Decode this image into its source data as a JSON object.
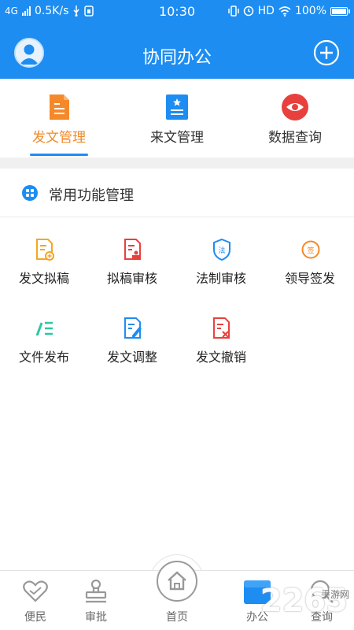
{
  "status": {
    "network": "4G",
    "speed": "0.5K/s",
    "time": "10:30",
    "hd": "HD",
    "battery": "100%"
  },
  "header": {
    "title": "协同办公"
  },
  "tabs": [
    {
      "label": "发文管理",
      "icon": "document-icon",
      "color": "#f5892a",
      "active": true
    },
    {
      "label": "来文管理",
      "icon": "receive-document-icon",
      "color": "#1d8df2",
      "active": false
    },
    {
      "label": "数据查询",
      "icon": "eye-icon",
      "color": "#e8413d",
      "active": false
    }
  ],
  "section": {
    "title": "常用功能管理"
  },
  "functions": [
    {
      "label": "发文拟稿",
      "icon": "draft-icon",
      "color": "#f5a623"
    },
    {
      "label": "拟稿审核",
      "icon": "review-stamp-icon",
      "color": "#e8413d"
    },
    {
      "label": "法制审核",
      "icon": "law-shield-icon",
      "color": "#1d8df2"
    },
    {
      "label": "领导签发",
      "icon": "sign-icon",
      "color": "#f5892a"
    },
    {
      "label": "文件发布",
      "icon": "publish-icon",
      "color": "#2cc7a4"
    },
    {
      "label": "发文调整",
      "icon": "edit-icon",
      "color": "#1d8df2"
    },
    {
      "label": "发文撤销",
      "icon": "revoke-icon",
      "color": "#e8413d"
    }
  ],
  "bottom_nav": [
    {
      "label": "便民",
      "icon": "heart-icon",
      "active": false
    },
    {
      "label": "审批",
      "icon": "stamp-icon",
      "active": false
    },
    {
      "label": "首页",
      "icon": "home-icon",
      "active": false
    },
    {
      "label": "办公",
      "icon": "office-icon",
      "active": true
    },
    {
      "label": "查询",
      "icon": "search-icon",
      "active": false
    }
  ],
  "watermark": {
    "text": "2265",
    "sub": "手游网"
  }
}
